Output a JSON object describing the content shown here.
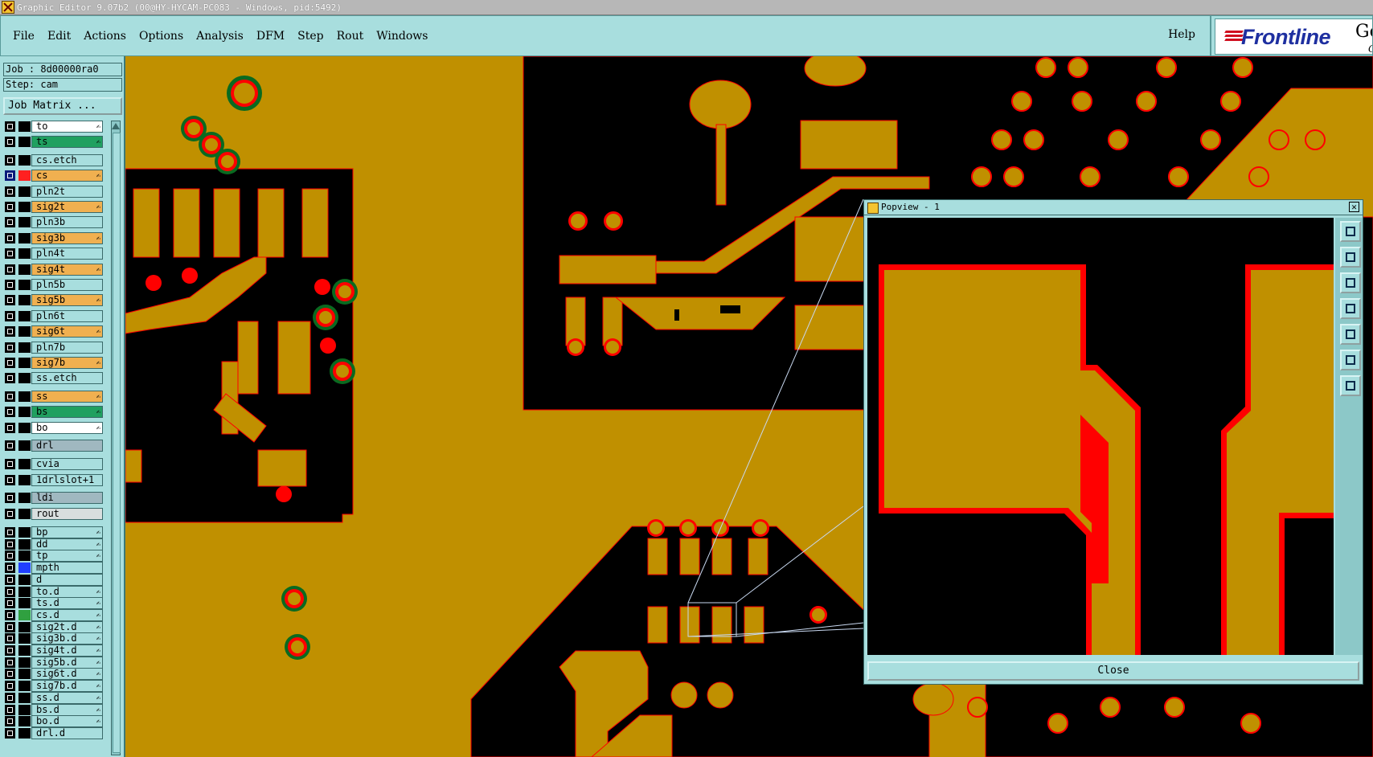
{
  "window": {
    "title": "Graphic Editor 9.07b2 (00@HY-HYCAM-PC083 - Windows, pid:5492)"
  },
  "menu": {
    "items": [
      "File",
      "Edit",
      "Actions",
      "Options",
      "Analysis",
      "DFM",
      "Step",
      "Rout",
      "Windows"
    ],
    "help": "Help"
  },
  "logo": {
    "brand": "Frontline",
    "product_fragment": "Ge",
    "product_fragment2": "G"
  },
  "info": {
    "job": "Job : 8d00000ra0",
    "step": "Step: cam",
    "job_matrix": "Job Matrix ..."
  },
  "colors": {
    "board": "#c09000",
    "copper_edge": "#ff0000",
    "void": "#000000",
    "panel": "#a8dede",
    "orange_layer": "#f0b050",
    "green_layer": "#20a060",
    "white_layer": "#ffffff",
    "gray_layer": "#a0b8c0",
    "light_layer": "#d8dede"
  },
  "layers": [
    {
      "name": "to",
      "color": "white",
      "mark": "✍"
    },
    {
      "name": "ts",
      "color": "green",
      "mark": "✍"
    },
    {
      "name": "cs.etch",
      "color": "panel",
      "mark": ""
    },
    {
      "name": "cs",
      "color": "orange",
      "mark": "✍",
      "active": true,
      "swatch": "#ff2020"
    },
    {
      "name": "pln2t",
      "color": "panel",
      "mark": ""
    },
    {
      "name": "sig2t",
      "color": "orange",
      "mark": "✍"
    },
    {
      "name": "pln3b",
      "color": "panel",
      "mark": ""
    },
    {
      "name": "sig3b",
      "color": "orange",
      "mark": "✍"
    },
    {
      "name": "pln4t",
      "color": "panel",
      "mark": ""
    },
    {
      "name": "sig4t",
      "color": "orange",
      "mark": "✍"
    },
    {
      "name": "pln5b",
      "color": "panel",
      "mark": ""
    },
    {
      "name": "sig5b",
      "color": "orange",
      "mark": "✍"
    },
    {
      "name": "pln6t",
      "color": "panel",
      "mark": ""
    },
    {
      "name": "sig6t",
      "color": "orange",
      "mark": "✍"
    },
    {
      "name": "pln7b",
      "color": "panel",
      "mark": ""
    },
    {
      "name": "sig7b",
      "color": "orange",
      "mark": "✍"
    },
    {
      "name": "ss.etch",
      "color": "panel",
      "mark": ""
    },
    {
      "name": "ss",
      "color": "orange",
      "mark": "✍"
    },
    {
      "name": "bs",
      "color": "green",
      "mark": "✍"
    },
    {
      "name": "bo",
      "color": "white",
      "mark": "✍"
    },
    {
      "name": "drl",
      "color": "gray",
      "mark": ""
    },
    {
      "name": "cvia",
      "color": "panel",
      "mark": ""
    },
    {
      "name": "1drlslot+1",
      "color": "panel",
      "mark": ""
    },
    {
      "name": "ldi",
      "color": "gray",
      "mark": ""
    },
    {
      "name": "rout",
      "color": "light",
      "mark": ""
    },
    {
      "name": "bp",
      "color": "panel",
      "mark": "✍"
    },
    {
      "name": "dd",
      "color": "panel",
      "mark": "✍"
    },
    {
      "name": "tp",
      "color": "panel",
      "mark": "✍"
    },
    {
      "name": "mpth",
      "color": "panel",
      "mark": "",
      "swatch": "#2040ff"
    },
    {
      "name": "d",
      "color": "panel",
      "mark": ""
    },
    {
      "name": "to.d",
      "color": "panel",
      "mark": "✍"
    },
    {
      "name": "ts.d",
      "color": "panel",
      "mark": "✍"
    },
    {
      "name": "cs.d",
      "color": "panel",
      "mark": "✍",
      "swatch": "#30a040"
    },
    {
      "name": "sig2t.d",
      "color": "panel",
      "mark": "✍"
    },
    {
      "name": "sig3b.d",
      "color": "panel",
      "mark": "✍"
    },
    {
      "name": "sig4t.d",
      "color": "panel",
      "mark": "✍"
    },
    {
      "name": "sig5b.d",
      "color": "panel",
      "mark": "✍"
    },
    {
      "name": "sig6t.d",
      "color": "panel",
      "mark": "✍"
    },
    {
      "name": "sig7b.d",
      "color": "panel",
      "mark": "✍"
    },
    {
      "name": "ss.d",
      "color": "panel",
      "mark": "✍"
    },
    {
      "name": "bs.d",
      "color": "panel",
      "mark": "✍"
    },
    {
      "name": "bo.d",
      "color": "panel",
      "mark": "✍"
    },
    {
      "name": "drl.d",
      "color": "panel",
      "mark": ""
    }
  ],
  "popview": {
    "title": "Popview - 1",
    "close_label": "Close",
    "close_x": "✕"
  },
  "icons": [
    "window-icon",
    "frontline-logo",
    "popview-icon",
    "close-icon",
    "zoom-tool-icon",
    "pan-up-icon",
    "pan-down-icon",
    "pan-left-icon",
    "pan-right-icon",
    "fit-icon",
    "center-icon"
  ]
}
